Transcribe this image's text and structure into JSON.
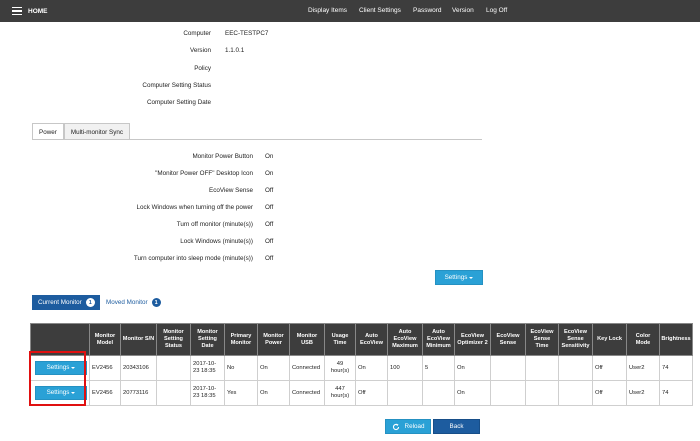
{
  "topbar": {
    "home_label": "HOME",
    "nav": [
      "Display Items",
      "Client Settings",
      "Password",
      "Version",
      "Log Off"
    ]
  },
  "info": [
    {
      "label": "Computer",
      "value": "EEC-TESTPC7"
    },
    {
      "label": "Version",
      "value": "1.1.0.1"
    },
    {
      "label": "Policy",
      "value": ""
    },
    {
      "label": "Computer Setting Status",
      "value": ""
    },
    {
      "label": "Computer Setting Date",
      "value": ""
    }
  ],
  "tabs": [
    "Power",
    "Multi-monitor Sync"
  ],
  "power_settings": [
    {
      "label": "Monitor Power Button",
      "value": "On"
    },
    {
      "label": "\"Monitor Power OFF\" Desktop Icon",
      "value": "On"
    },
    {
      "label": "EcoView Sense",
      "value": "Off"
    },
    {
      "label": "Lock Windows when turning off the power",
      "value": "Off"
    },
    {
      "label": "Turn off monitor (minute(s))",
      "value": "Off"
    },
    {
      "label": "Lock Windows (minute(s))",
      "value": "Off"
    },
    {
      "label": "Turn computer into sleep mode (minute(s))",
      "value": "Off"
    }
  ],
  "settings_button": "Settings",
  "monitor_tabs": {
    "current": {
      "label": "Current Monitor",
      "count": "1"
    },
    "moved": {
      "label": "Moved Monitor",
      "count": "1"
    }
  },
  "table": {
    "headers": [
      "",
      "Monitor Model",
      "Monitor S/N",
      "Monitor Setting Status",
      "Monitor Setting Date",
      "Primary Monitor",
      "Monitor Power",
      "Monitor USB",
      "Usage Time",
      "Auto EcoView",
      "Auto EcoView Maximum",
      "Auto EcoView Minimum",
      "EcoView Optimizer 2",
      "EcoView Sense",
      "EcoView Sense Time",
      "EcoView Sense Sensitivity",
      "Key Lock",
      "Color Mode",
      "Brightness"
    ],
    "rows": [
      {
        "button": "Settings",
        "cells": [
          "EV2456",
          "20343106",
          "",
          "2017-10-23 18:35",
          "No",
          "On",
          "Connected",
          "49 hour(s)",
          "On",
          "100",
          "5",
          "On",
          "",
          "",
          "",
          "Off",
          "User2",
          "74"
        ]
      },
      {
        "button": "Settings",
        "cells": [
          "EV2456",
          "20773116",
          "",
          "2017-10-23 18:35",
          "Yes",
          "On",
          "Connected",
          "447 hour(s)",
          "Off",
          "",
          "",
          "On",
          "",
          "",
          "",
          "Off",
          "User2",
          "74"
        ]
      }
    ]
  },
  "footer": {
    "reload": "Reload",
    "back": "Back"
  },
  "colors": {
    "accent": "#2aa1d6",
    "nav": "#3d3d3d",
    "tab_active": "#1d5c9f",
    "highlight": "#e01010"
  }
}
